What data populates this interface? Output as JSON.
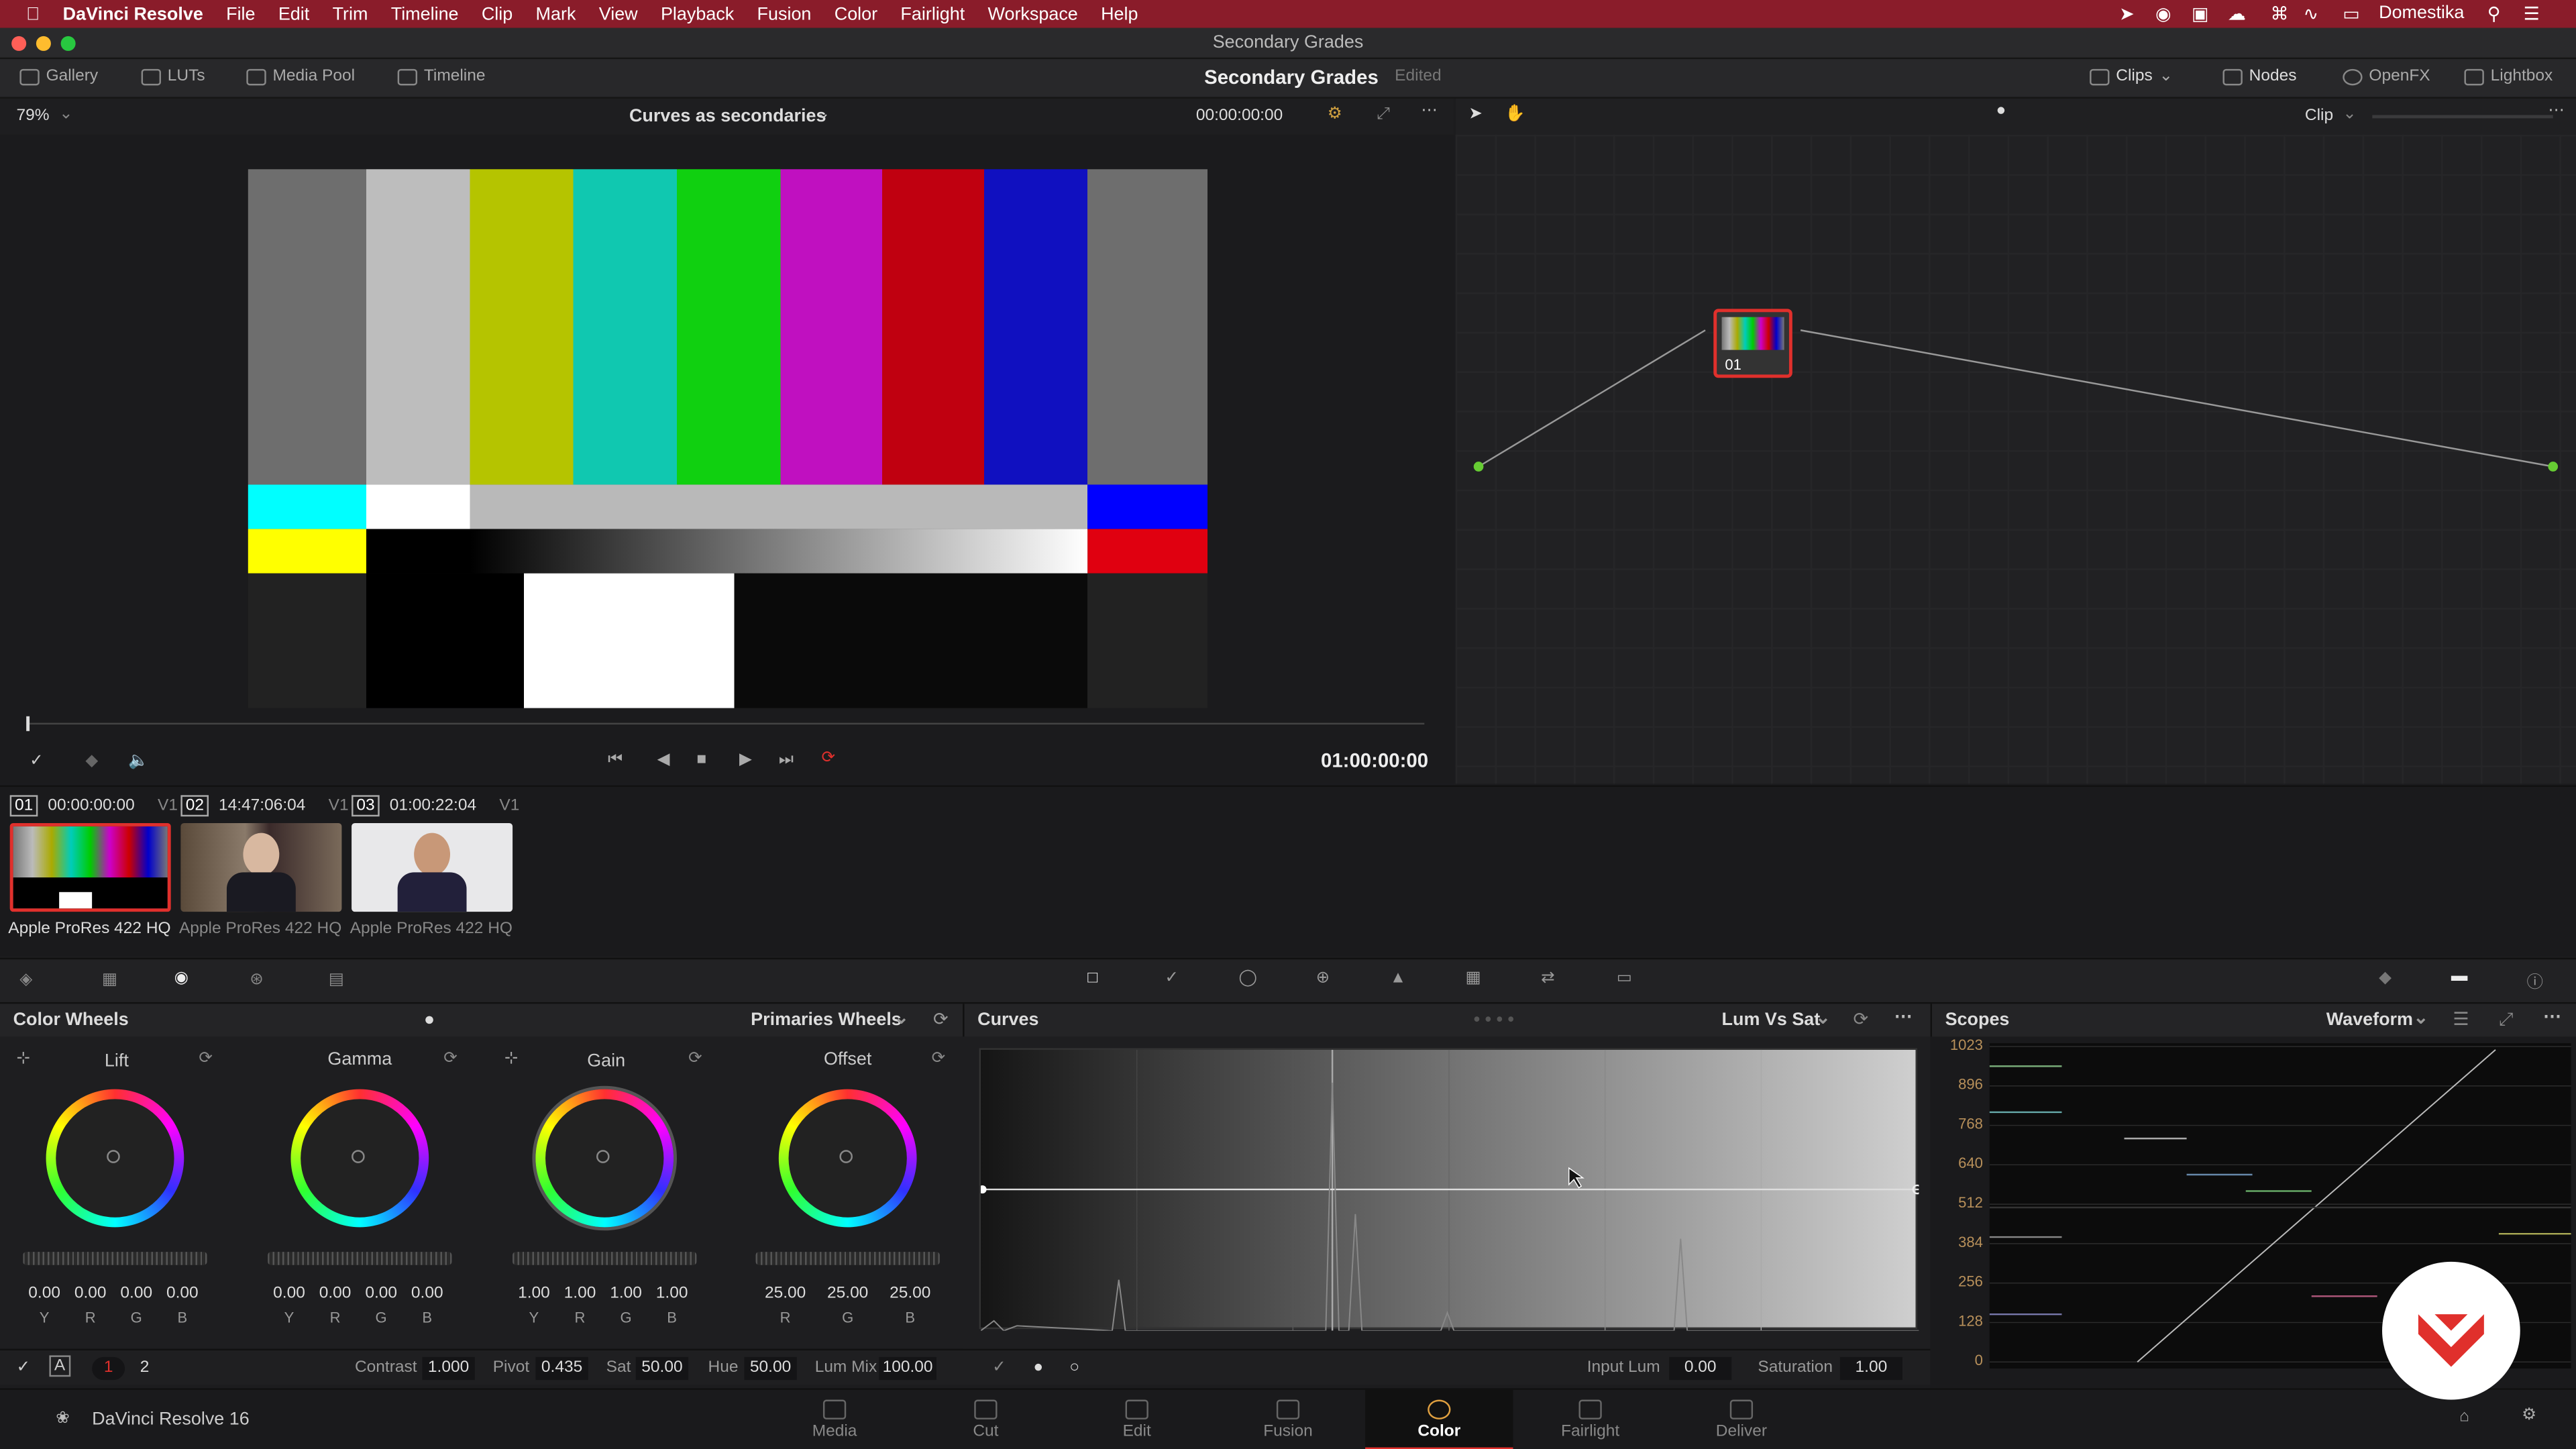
{
  "menubar": {
    "app": "DaVinci Resolve",
    "items": [
      "File",
      "Edit",
      "Trim",
      "Timeline",
      "Clip",
      "Mark",
      "View",
      "Playback",
      "Fusion",
      "Color",
      "Fairlight",
      "Workspace",
      "Help"
    ],
    "user": "Domestika"
  },
  "window": {
    "title": "Secondary Grades"
  },
  "toolbar": {
    "gallery": "Gallery",
    "luts": "LUTs",
    "media_pool": "Media Pool",
    "timeline": "Timeline",
    "project": "Secondary Grades",
    "status": "Edited",
    "clips": "Clips",
    "nodes": "Nodes",
    "openfx": "OpenFX",
    "lightbox": "Lightbox"
  },
  "viewer": {
    "zoom": "79%",
    "title": "Curves as secondaries",
    "timecode_top": "00:00:00:00",
    "timecode": "01:00:00:00"
  },
  "nodes": {
    "mode": "Clip",
    "node_label": "01"
  },
  "clips": [
    {
      "num": "01",
      "tc": "00:00:00:00",
      "track": "V1",
      "codec": "Apple ProRes 422 HQ"
    },
    {
      "num": "02",
      "tc": "14:47:06:04",
      "track": "V1",
      "codec": "Apple ProRes 422 HQ"
    },
    {
      "num": "03",
      "tc": "01:00:22:04",
      "track": "V1",
      "codec": "Apple ProRes 422 HQ"
    }
  ],
  "color_wheels": {
    "title": "Color Wheels",
    "mode": "Primaries Wheels",
    "wheels": [
      {
        "name": "Lift",
        "values": [
          "0.00",
          "0.00",
          "0.00",
          "0.00"
        ],
        "channels": [
          "Y",
          "R",
          "G",
          "B"
        ]
      },
      {
        "name": "Gamma",
        "values": [
          "0.00",
          "0.00",
          "0.00",
          "0.00"
        ],
        "channels": [
          "Y",
          "R",
          "G",
          "B"
        ]
      },
      {
        "name": "Gain",
        "values": [
          "1.00",
          "1.00",
          "1.00",
          "1.00"
        ],
        "channels": [
          "Y",
          "R",
          "G",
          "B"
        ]
      },
      {
        "name": "Offset",
        "values": [
          "25.00",
          "25.00",
          "25.00"
        ],
        "channels": [
          "R",
          "G",
          "B"
        ]
      }
    ]
  },
  "bottom": {
    "page1": "1",
    "page2": "2",
    "contrast_label": "Contrast",
    "contrast": "1.000",
    "pivot_label": "Pivot",
    "pivot": "0.435",
    "sat_label": "Sat",
    "sat": "50.00",
    "hue_label": "Hue",
    "hue": "50.00",
    "lummix_label": "Lum Mix",
    "lummix": "100.00",
    "inputlum_label": "Input Lum",
    "inputlum": "0.00",
    "saturation_label": "Saturation",
    "saturation": "1.00"
  },
  "curves": {
    "title": "Curves",
    "mode": "Lum Vs Sat"
  },
  "scopes": {
    "title": "Scopes",
    "mode": "Waveform",
    "labels": [
      "1023",
      "896",
      "768",
      "640",
      "512",
      "384",
      "256",
      "128",
      "0"
    ]
  },
  "pages": [
    "Media",
    "Cut",
    "Edit",
    "Fusion",
    "Color",
    "Fairlight",
    "Deliver"
  ],
  "app_version": "DaVinci Resolve 16",
  "colors": {
    "accent": "#e0302c",
    "menubar": "#8a1c2a"
  }
}
